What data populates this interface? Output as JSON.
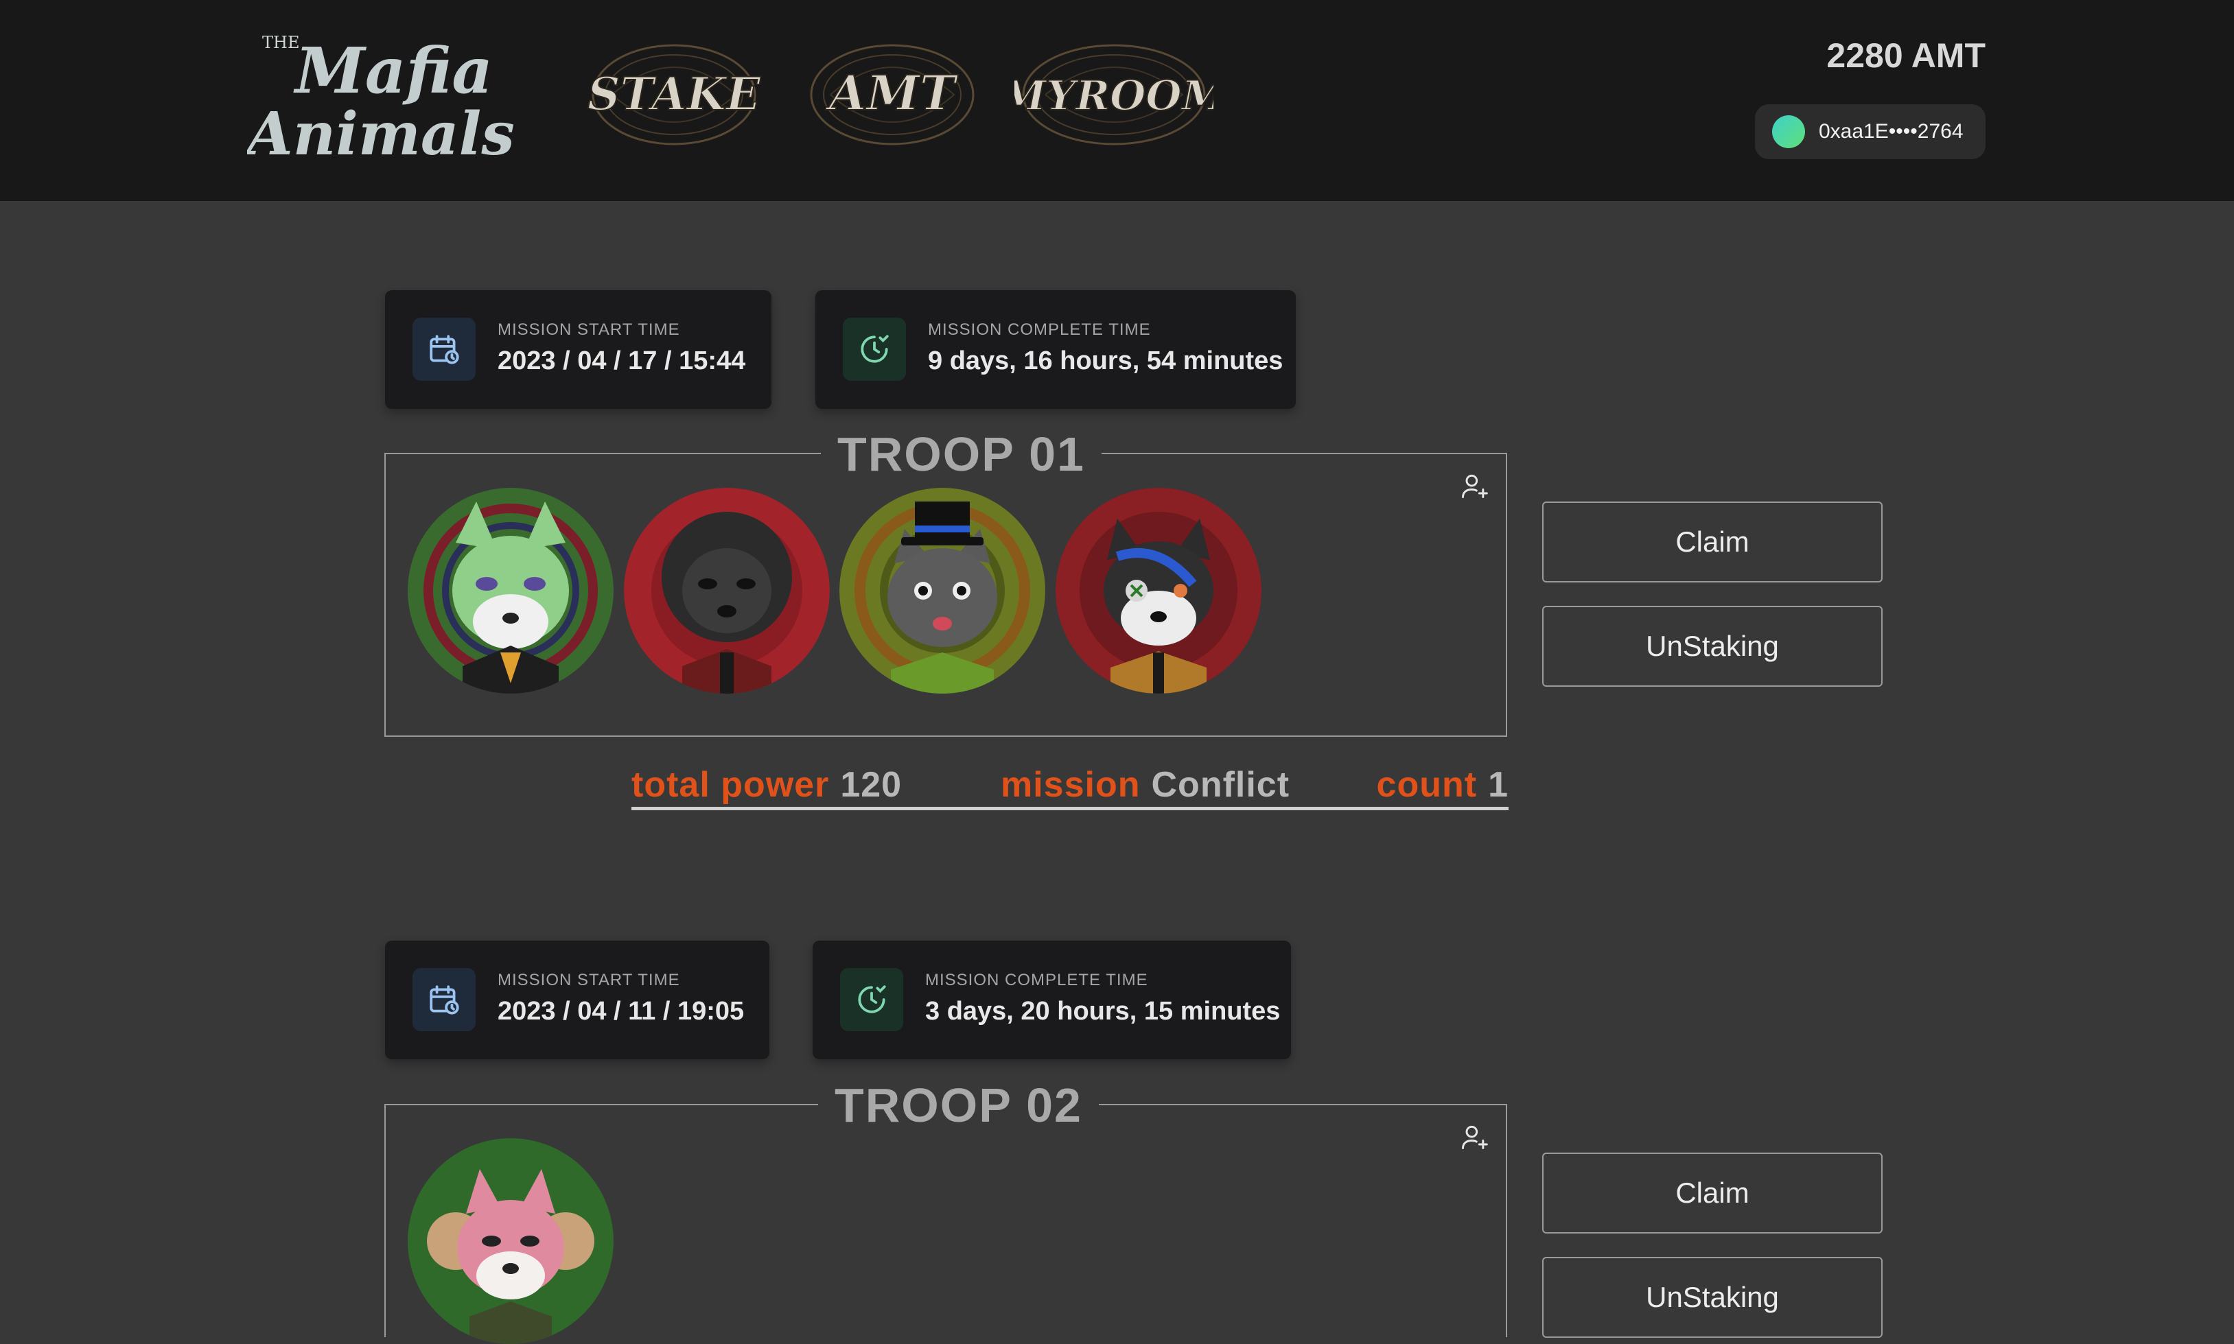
{
  "header": {
    "logo_the": "THE",
    "logo_line1": "Mafia",
    "logo_line2": "Animals",
    "nav": [
      {
        "label": "STAKE"
      },
      {
        "label": "AMT"
      },
      {
        "label": "MYROOM"
      }
    ],
    "balance": "2280 AMT",
    "wallet_address": "0xaa1E••••2764"
  },
  "troops": [
    {
      "title": "TROOP 01",
      "start_label": "MISSION START TIME",
      "start_value": "2023 / 04 / 17 / 15:44",
      "complete_label": "MISSION COMPLETE TIME",
      "complete_value": "9 days, 16 hours, 54 minutes",
      "claim_label": "Claim",
      "unstake_label": "UnStaking",
      "stats": {
        "power_key": "total power",
        "power_value": "120",
        "mission_key": "mission",
        "mission_value": "Conflict",
        "count_key": "count",
        "count_value": "1"
      }
    },
    {
      "title": "TROOP 02",
      "start_label": "MISSION START TIME",
      "start_value": "2023 / 04 / 11 / 19:05",
      "complete_label": "MISSION COMPLETE TIME",
      "complete_value": "3 days, 20 hours, 15 minutes",
      "claim_label": "Claim",
      "unstake_label": "UnStaking"
    }
  ],
  "colors": {
    "accent_orange": "#e0521a",
    "background": "#383838",
    "header_bg": "#181818"
  }
}
